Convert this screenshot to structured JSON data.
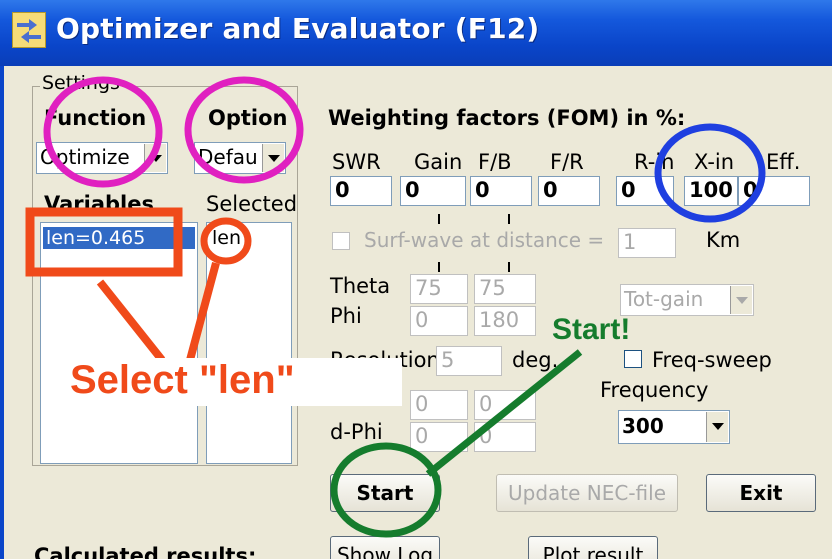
{
  "window": {
    "title": "Optimizer and Evaluator (F12)"
  },
  "settings": {
    "legend": "Settings",
    "function_label": "Function",
    "function_value": "Optimize",
    "option_label": "Option",
    "option_value": "Defau",
    "variables_label": "Variables",
    "selected_label": "Selected",
    "variables": [
      "len=0.465"
    ],
    "selected": [
      "len"
    ]
  },
  "weighting": {
    "title": "Weighting factors (FOM) in %:",
    "headers": [
      "SWR",
      "Gain",
      "F/B",
      "F/R",
      "R-in",
      "X-in",
      "Eff."
    ],
    "values": [
      "0",
      "0",
      "0",
      "0",
      "0",
      "100",
      "0"
    ]
  },
  "surf_wave": {
    "label": "Surf-wave at distance =",
    "value": "1",
    "unit": "Km"
  },
  "angles": {
    "theta_label": "Theta",
    "theta_values": [
      "75",
      "75"
    ],
    "phi_label": "Phi",
    "phi_values": [
      "0",
      "180"
    ],
    "gain_type": "Tot-gain"
  },
  "resolution": {
    "label": "Resolution",
    "value": "5",
    "unit": "deg."
  },
  "d_theta": {
    "values": [
      "0",
      "0"
    ]
  },
  "d_phi": {
    "label": "d-Phi",
    "values": [
      "0",
      "0"
    ]
  },
  "freq_sweep": {
    "label": "Freq-sweep",
    "checked": false
  },
  "frequency": {
    "label": "Frequency",
    "value": "300"
  },
  "buttons": {
    "start": "Start",
    "update": "Update NEC-file",
    "exit": "Exit",
    "show_log": "Show Log",
    "plot_result": "Plot result"
  },
  "results": {
    "label": "Calculated results:"
  },
  "annotations": {
    "select_len": "Select \"len\"",
    "start": "Start!",
    "colors": {
      "magenta": "#e020c0",
      "orange": "#f04a1a",
      "blue": "#1f3fe0",
      "green": "#157c2d"
    }
  }
}
